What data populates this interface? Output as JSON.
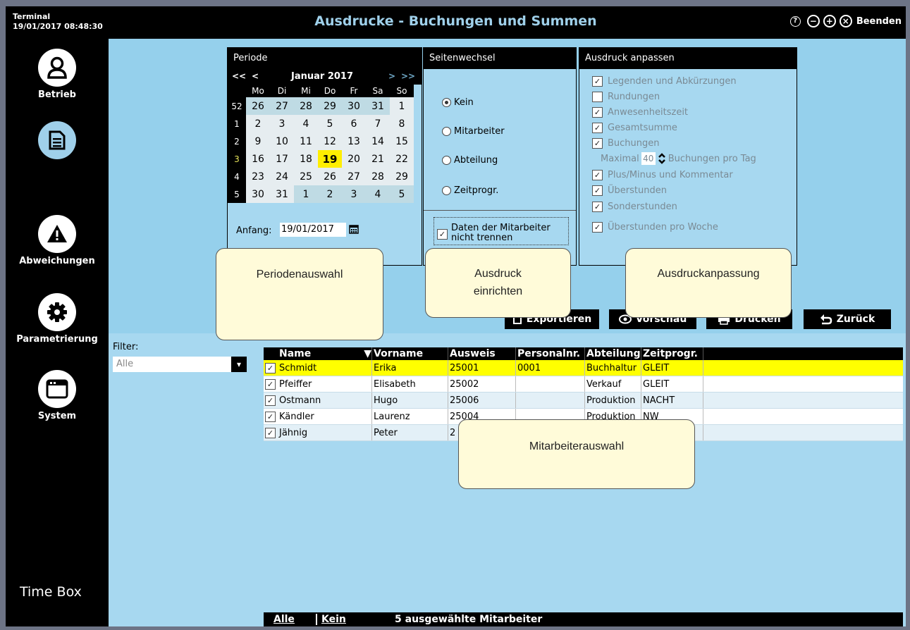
{
  "header": {
    "terminal_label": "Terminal",
    "datetime": "19/01/2017 08:48:30",
    "title": "Ausdrucke - Buchungen und Summen",
    "help_glyph": "?",
    "minus_glyph": "−",
    "plus_glyph": "+",
    "close_glyph": "×",
    "exit_label": "Beenden"
  },
  "sidebar": {
    "items": [
      {
        "label": "Betrieb",
        "icon": "user-icon"
      },
      {
        "label": "",
        "icon": "document-icon"
      },
      {
        "label": "Abweichungen",
        "icon": "warning-icon"
      },
      {
        "label": "Parametrierung",
        "icon": "gear-icon"
      },
      {
        "label": "System",
        "icon": "window-icon"
      }
    ],
    "brand": "Time Box"
  },
  "periode": {
    "title": "Periode",
    "nav_first": "<<",
    "nav_prev": "<",
    "month": "Januar 2017",
    "nav_next": ">",
    "nav_last": ">>",
    "weekdays": [
      "Mo",
      "Di",
      "Mi",
      "Do",
      "Fr",
      "Sa",
      "So"
    ],
    "weeks": [
      {
        "wk": "52",
        "days": [
          "26",
          "27",
          "28",
          "29",
          "30",
          "31",
          "1"
        ]
      },
      {
        "wk": "1",
        "days": [
          "2",
          "3",
          "4",
          "5",
          "6",
          "7",
          "8"
        ]
      },
      {
        "wk": "2",
        "days": [
          "9",
          "10",
          "11",
          "12",
          "13",
          "14",
          "15"
        ]
      },
      {
        "wk": "3",
        "days": [
          "16",
          "17",
          "18",
          "19",
          "20",
          "21",
          "22"
        ]
      },
      {
        "wk": "4",
        "days": [
          "23",
          "24",
          "25",
          "26",
          "27",
          "28",
          "29"
        ]
      },
      {
        "wk": "5",
        "days": [
          "30",
          "31",
          "1",
          "2",
          "3",
          "4",
          "5"
        ]
      }
    ],
    "start_label": "Anfang:",
    "start_value": "19/01/2017"
  },
  "seitenwechsel": {
    "title": "Seitenwechsel",
    "options": [
      "Kein",
      "Mitarbeiter",
      "Abteilung",
      "Zeitprogr."
    ],
    "selected": "Kein",
    "nosplit_label": "Daten der Mitarbeiter nicht trennen"
  },
  "anpassen": {
    "title": "Ausdruck anpassen",
    "opt_legenden": "Legenden und Abkürzungen",
    "opt_rundungen": "Rundungen",
    "opt_anwesenheit": "Anwesenheitszeit",
    "opt_gesamt": "Gesamtsumme",
    "opt_buchungen": "Buchungen",
    "max_label": "Maximal",
    "max_value": "40",
    "max_suffix": "Buchungen pro Tag",
    "opt_plusminus": "Plus/Minus und Kommentar",
    "opt_ueberstunden": "Überstunden",
    "opt_sonder": "Sonderstunden",
    "opt_woche": "Überstunden pro Woche"
  },
  "callouts": {
    "perioden": "Periodenauswahl",
    "einrichten_1": "Ausdruck",
    "einrichten_2": "einrichten",
    "anpassung": "Ausdruckanpassung",
    "mitarbeiter": "Mitarbeiterauswahl"
  },
  "actions": {
    "export": "Exportieren",
    "preview": "Vorschau",
    "print": "Drucken",
    "back": "Zurück"
  },
  "filter": {
    "label": "Filter:",
    "value": "Alle"
  },
  "table": {
    "columns": [
      "Name",
      "Vorname",
      "Ausweis",
      "Personalnr.",
      "Abteilung",
      "Zeitprogr."
    ],
    "rows": [
      [
        "Schmidt",
        "Erika",
        "25001",
        "0001",
        "Buchhaltur",
        "GLEIT"
      ],
      [
        "Pfeiffer",
        "Elisabeth",
        "25002",
        "",
        "Verkauf",
        "GLEIT"
      ],
      [
        "Ostmann",
        "Hugo",
        "25006",
        "",
        "Produktion",
        "NACHT"
      ],
      [
        "Kändler",
        "Laurenz",
        "25004",
        "",
        "Produktion",
        "NW"
      ],
      [
        "Jähnig",
        "Peter",
        "2",
        "",
        "",
        ""
      ]
    ]
  },
  "footer": {
    "all": "Alle",
    "none": "Kein",
    "count": "5 ausgewählte Mitarbeiter"
  },
  "colors": {
    "accent": "#9fd0ea",
    "panel": "#a7d8f0",
    "highlight": "#ffff00",
    "today": "#ffee00"
  }
}
